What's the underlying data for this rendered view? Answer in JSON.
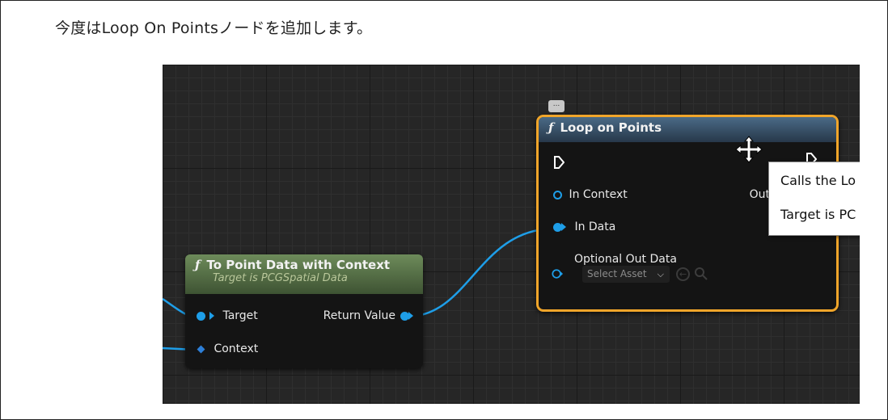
{
  "instruction": "今度はLoop On Pointsノードを追加します。",
  "nodes": {
    "to_point_data": {
      "title": "To Point Data with Context",
      "subtitle": "Target is PCGSpatial Data",
      "inputs": [
        "Target",
        "Context"
      ],
      "output": "Return Value"
    },
    "loop_on_points": {
      "title": "Loop on Points",
      "inputs": [
        "In Context",
        "In Data",
        "Optional Out Data"
      ],
      "output": "Out",
      "asset_select": "Select Asset"
    }
  },
  "comment_bubble": "...",
  "tooltip": {
    "line1": "Calls the Lo",
    "line2": "Target is PC"
  },
  "colors": {
    "pin_blue": "#1e9ee8",
    "selection_orange": "#f0a52a",
    "pure_header_green": "#6d8b5a",
    "function_header_blue": "#4a6a86"
  }
}
